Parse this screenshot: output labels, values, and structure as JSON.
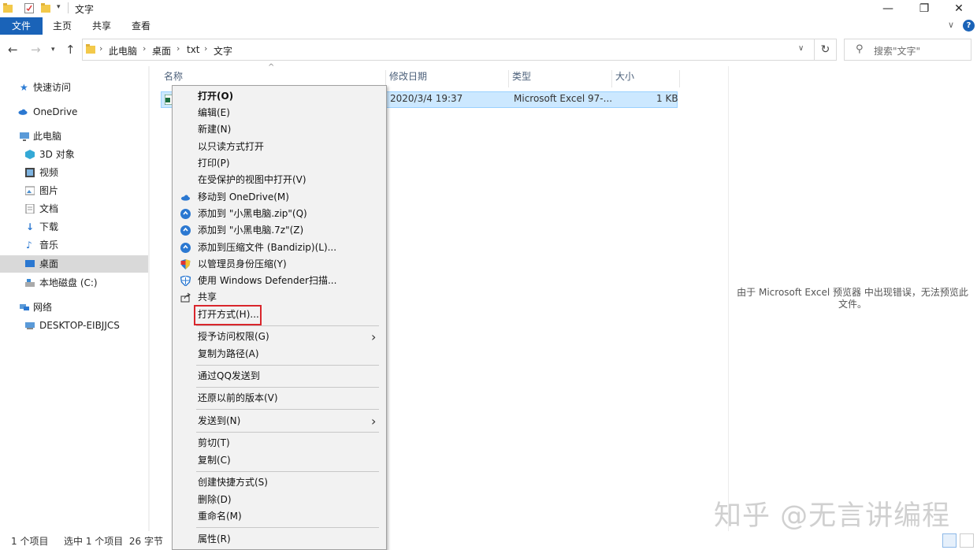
{
  "window": {
    "title": "文字",
    "minimize_glyph": "—",
    "restore_glyph": "❐",
    "close_glyph": "✕"
  },
  "ribbon": {
    "tabs": [
      "文件",
      "主页",
      "共享",
      "查看"
    ],
    "expand_glyph": "∨",
    "help_glyph": "?"
  },
  "address": {
    "crumbs": [
      "此电脑",
      "桌面",
      "txt",
      "文字"
    ],
    "search_placeholder": "搜索\"文字\""
  },
  "sidebar": {
    "items": [
      {
        "label": "快速访问",
        "icon": "star-icon"
      },
      {
        "label": "OneDrive",
        "icon": "cloud-icon"
      },
      {
        "label": "此电脑",
        "icon": "computer-icon"
      },
      {
        "label": "3D 对象",
        "icon": "cube-icon"
      },
      {
        "label": "视频",
        "icon": "video-icon"
      },
      {
        "label": "图片",
        "icon": "picture-icon"
      },
      {
        "label": "文档",
        "icon": "document-icon"
      },
      {
        "label": "下载",
        "icon": "download-icon"
      },
      {
        "label": "音乐",
        "icon": "music-icon"
      },
      {
        "label": "桌面",
        "icon": "desktop-icon"
      },
      {
        "label": "本地磁盘 (C:)",
        "icon": "drive-icon"
      },
      {
        "label": "网络",
        "icon": "network-icon"
      },
      {
        "label": "DESKTOP-EIBJJCS",
        "icon": "pc-icon"
      }
    ],
    "selected": "桌面"
  },
  "columns": {
    "name": "名称",
    "modified": "修改日期",
    "type": "类型",
    "size": "大小"
  },
  "file": {
    "modified": "2020/3/4 19:37",
    "type": "Microsoft Excel 97-...",
    "size": "1 KB"
  },
  "preview": {
    "message": "由于 Microsoft Excel 预览器 中出现错误，无法预览此文件。"
  },
  "status": {
    "count": "1 个项目",
    "selected": "选中 1 个项目  26 字节"
  },
  "context_menu": {
    "items": [
      {
        "label": "打开(O)",
        "bold": true
      },
      {
        "label": "编辑(E)"
      },
      {
        "label": "新建(N)"
      },
      {
        "label": "以只读方式打开"
      },
      {
        "label": "打印(P)"
      },
      {
        "label": "在受保护的视图中打开(V)"
      },
      {
        "label": "移动到 OneDrive(M)",
        "icon": "onedrive-icon"
      },
      {
        "label": "添加到 \"小黑电脑.zip\"(Q)",
        "icon": "bandizip-icon"
      },
      {
        "label": "添加到 \"小黑电脑.7z\"(Z)",
        "icon": "bandizip-icon"
      },
      {
        "label": "添加到压缩文件 (Bandizip)(L)...",
        "icon": "bandizip-icon"
      },
      {
        "label": "以管理员身份压缩(Y)",
        "icon": "shield-icon"
      },
      {
        "label": "使用 Windows Defender扫描...",
        "icon": "defender-icon"
      },
      {
        "label": "共享",
        "icon": "share-icon"
      },
      {
        "label": "打开方式(H)..."
      },
      {
        "label": "授予访问权限(G)",
        "submenu": true
      },
      {
        "label": "复制为路径(A)"
      },
      {
        "label": "通过QQ发送到"
      },
      {
        "label": "还原以前的版本(V)"
      },
      {
        "label": "发送到(N)",
        "submenu": true
      },
      {
        "label": "剪切(T)"
      },
      {
        "label": "复制(C)"
      },
      {
        "label": "创建快捷方式(S)"
      },
      {
        "label": "删除(D)"
      },
      {
        "label": "重命名(M)"
      },
      {
        "label": "属性(R)"
      }
    ]
  },
  "watermark": "知乎 @无言讲编程",
  "colors": {
    "accent": "#1a63b8",
    "selection": "#cce8ff",
    "highlight_box": "#d9262c"
  }
}
